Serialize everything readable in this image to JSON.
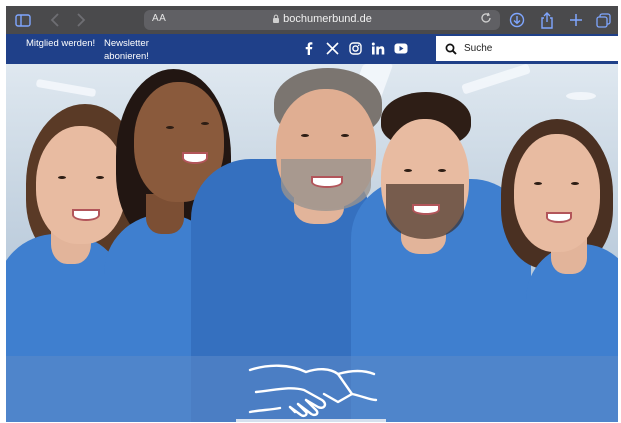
{
  "browser": {
    "text_size_label": "AA",
    "url": "bochumerbund.de",
    "accent_color": "#7fa6ff"
  },
  "header": {
    "background_color": "#1f4089",
    "links": {
      "member": "Mitglied werden!",
      "newsletter_line1": "Newsletter",
      "newsletter_line2": "abonieren!"
    },
    "social": [
      "facebook-icon",
      "x-icon",
      "instagram-icon",
      "linkedin-icon",
      "youtube-icon"
    ],
    "search": {
      "placeholder": "Suche"
    }
  },
  "hero": {
    "band_color": "#5d8ac9",
    "logo": "handshake-icon"
  }
}
